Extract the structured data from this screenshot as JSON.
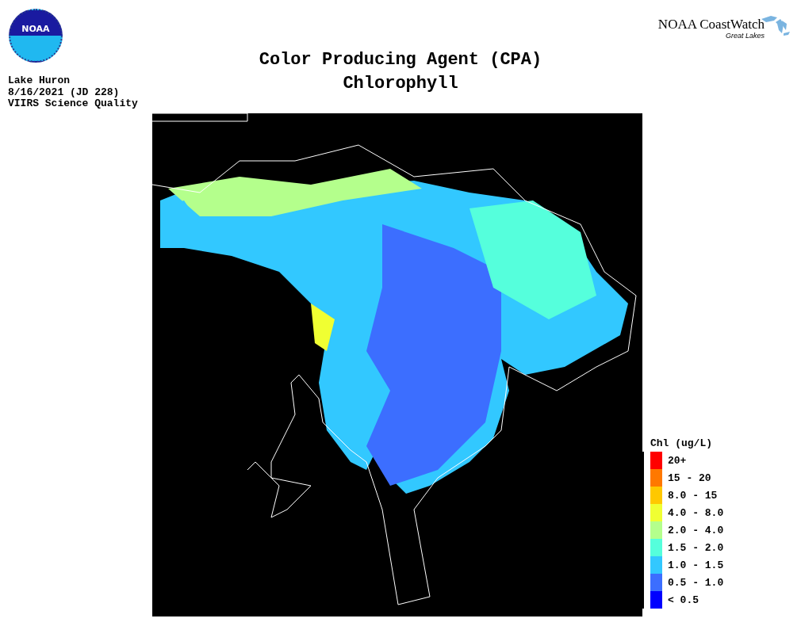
{
  "header": {
    "logo_text": "NOAA",
    "brand": "NOAA CoastWatch",
    "brand_sub": "Great Lakes"
  },
  "title": [
    "Color Producing Agent (CPA)",
    "Chlorophyll"
  ],
  "info": [
    "Lake Huron",
    "8/16/2021 (JD 228)",
    "VIIRS Science Quality"
  ],
  "legend": {
    "title": "Chl (ug/L)",
    "items": [
      {
        "label": "20+",
        "color": "#ff0000"
      },
      {
        "label": "15 - 20",
        "color": "#ff7800"
      },
      {
        "label": "8.0 - 15",
        "color": "#ffc800"
      },
      {
        "label": "4.0 - 8.0",
        "color": "#f0ff32"
      },
      {
        "label": "2.0 - 4.0",
        "color": "#b4ff8c"
      },
      {
        "label": "1.5 - 2.0",
        "color": "#55ffdc"
      },
      {
        "label": "1.0 - 1.5",
        "color": "#32c8ff"
      },
      {
        "label": "0.5 - 1.0",
        "color": "#3c6eff"
      },
      {
        "label": "< 0.5",
        "color": "#0000ff"
      }
    ]
  }
}
